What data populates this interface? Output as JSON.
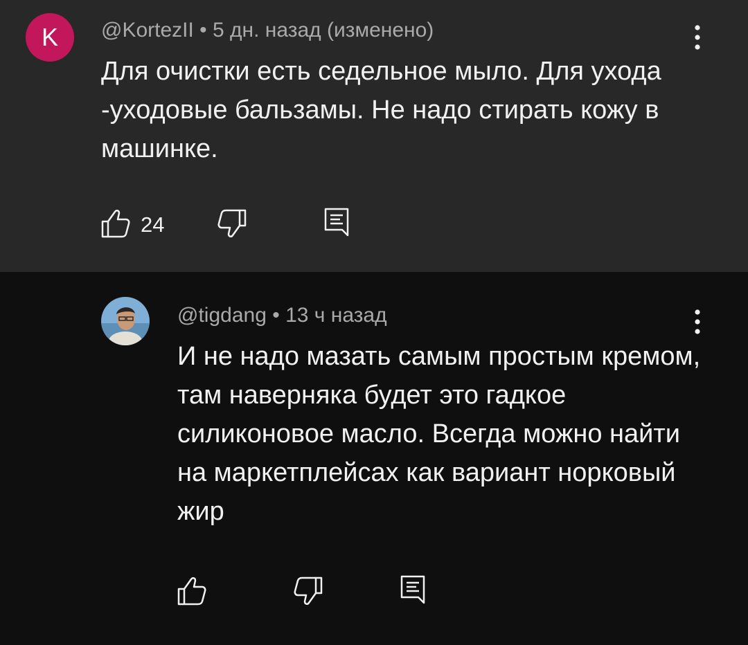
{
  "comments": [
    {
      "avatar_letter": "K",
      "avatar_color": "#c2185b",
      "author": "@KortezII",
      "separator": "•",
      "time": "5 дн. назад (изменено)",
      "text": "Для очистки есть седельное мыло. Для ухода -уходовые бальзамы. Не надо стирать кожу в машинке.",
      "likes": "24",
      "actions": [
        "like-icon",
        "dislike-icon",
        "reply-icon"
      ],
      "menu_icon": "more-vert-icon"
    },
    {
      "avatar": "user-photo",
      "author": "@tigdang",
      "separator": "•",
      "time": "13 ч назад",
      "text": "И не надо мазать самым простым кремом, там наверняка будет это гадкое силиконовое масло. Всегда можно найти на маркетплейсах как вариант норковый жир",
      "actions": [
        "like-icon",
        "dislike-icon",
        "reply-icon"
      ],
      "menu_icon": "more-vert-icon"
    }
  ],
  "colors": {
    "top_comment_bg": "#282828",
    "page_bg": "#0f0f0f",
    "meta_text": "#aaaaaa",
    "primary_text": "#f1f1f1"
  }
}
